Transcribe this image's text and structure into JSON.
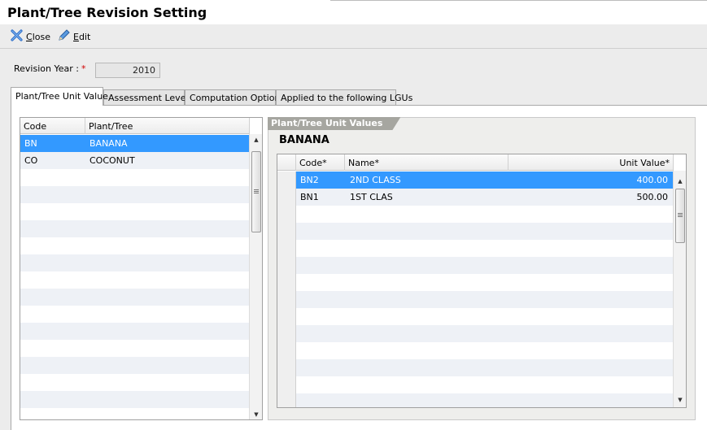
{
  "window": {
    "title": "Plant/Tree Revision Setting"
  },
  "toolbar": {
    "close_label": "Close",
    "close_mnemonic": "C",
    "close_rest": "lose",
    "edit_label": "Edit",
    "edit_mnemonic": "E",
    "edit_rest": "dit"
  },
  "revision": {
    "label": "Revision Year :",
    "required_mark": "*",
    "value": "2010"
  },
  "tabs": [
    {
      "label": "Plant/Tree Unit Value",
      "active": true
    },
    {
      "label": "Assessment Levels",
      "active": false
    },
    {
      "label": "Computation Options",
      "active": false
    },
    {
      "label": "Applied to the following LGUs",
      "active": false
    }
  ],
  "plant_grid": {
    "columns": [
      "Code",
      "Plant/Tree"
    ],
    "rows": [
      {
        "code": "BN",
        "name": "BANANA",
        "selected": true
      },
      {
        "code": "CO",
        "name": "COCONUT",
        "selected": false
      }
    ]
  },
  "unit_values": {
    "group_title": "Plant/Tree Unit Values",
    "selected_plant": "BANANA",
    "columns": [
      "Code*",
      "Name*",
      "Unit Value*"
    ],
    "rows": [
      {
        "code": "BN2",
        "name": "2ND CLASS",
        "unit_value": "400.00",
        "selected": true
      },
      {
        "code": "BN1",
        "name": "1ST CLAS",
        "unit_value": "500.00",
        "selected": false
      }
    ]
  },
  "colors": {
    "selection": "#3399ff",
    "alt_row": "#eef1f6",
    "required": "#d00000"
  }
}
